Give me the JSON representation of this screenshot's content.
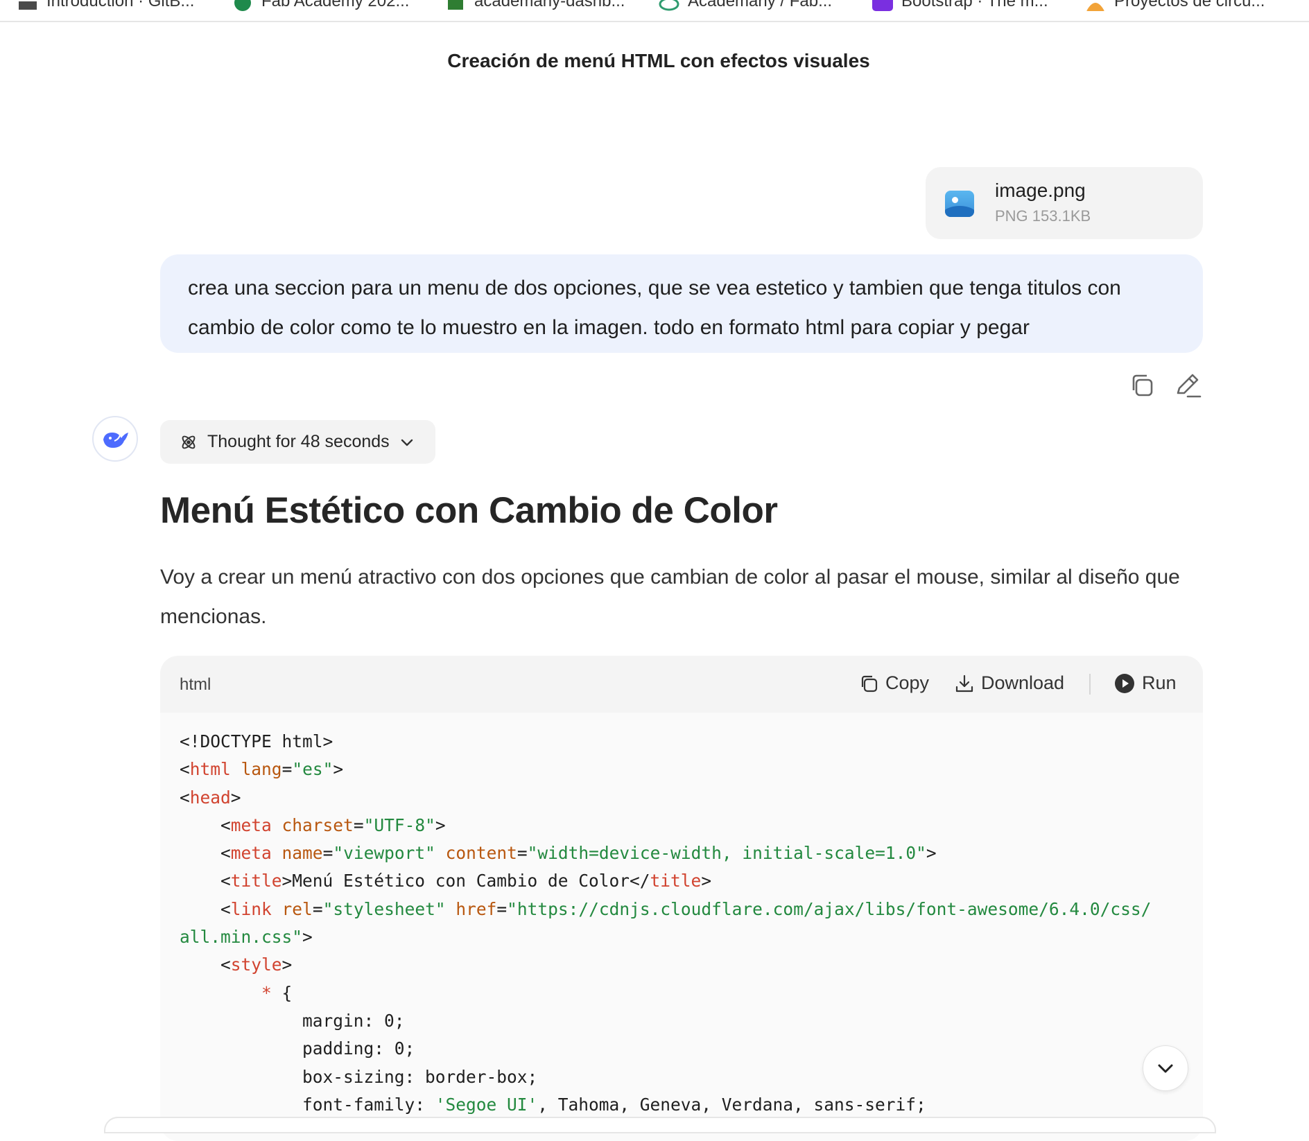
{
  "bookmarks_bar": [
    {
      "label": "Introduction · GitB...",
      "icon": "book-icon",
      "color": "#4a4a4a"
    },
    {
      "label": "Fab Academy 202...",
      "icon": "fab-globe-icon",
      "color": "#1f8a4c"
    },
    {
      "label": "academany-dashb...",
      "icon": "academany-icon",
      "color": "#2f7d32"
    },
    {
      "label": "Academany / Fab...",
      "icon": "globe-icon",
      "color": "#2f9b6f"
    },
    {
      "label": "Bootstrap · The m...",
      "icon": "bootstrap-icon",
      "color": "#7a2fe0"
    },
    {
      "label": "Proyectos de circu...",
      "icon": "person-icon",
      "color": "#f2a338"
    }
  ],
  "conversation": {
    "title": "Creación de menú HTML con efectos visuales"
  },
  "attachment": {
    "name": "image.png",
    "meta": "PNG 153.1KB"
  },
  "user_message": {
    "text": "crea una seccion para un menu de dos opciones, que se vea estetico y tambien que tenga  titulos con cambio de color como te lo muestro en la imagen. todo en formato html para copiar y pegar"
  },
  "assistant": {
    "thought_label": "Thought for 48 seconds",
    "heading": "Menú Estético con Cambio de Color",
    "intro": "Voy a crear un menú atractivo con dos opciones que cambian de color al pasar el mouse, similar al diseño que mencionas."
  },
  "code_block": {
    "language": "html",
    "copy_label": "Copy",
    "download_label": "Download",
    "run_label": "Run"
  },
  "colors": {
    "user_bubble": "#edf2fd",
    "code_tag": "#d1432f",
    "code_attr": "#b8570f",
    "code_string": "#23893f",
    "accent": "#4d6bfe"
  }
}
